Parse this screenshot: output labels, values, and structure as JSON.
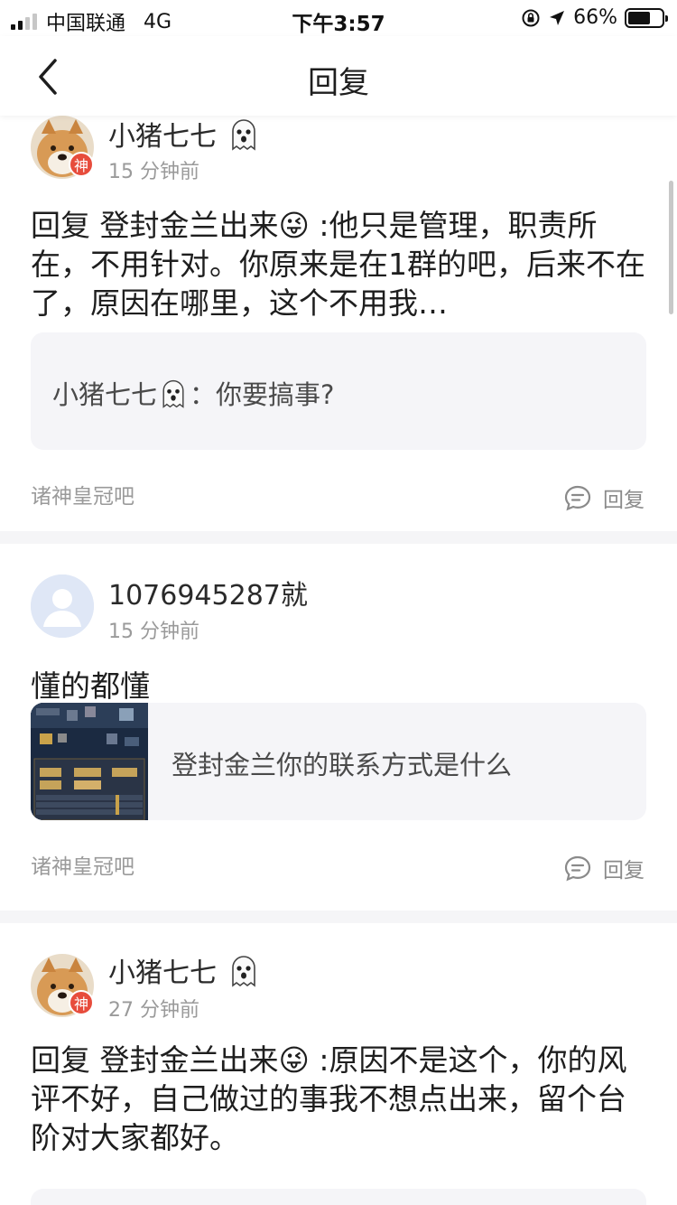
{
  "status_bar": {
    "carrier": "中国联通",
    "network": "4G",
    "time": "下午3:57",
    "battery_percent": "66%",
    "battery_level": 0.66
  },
  "nav": {
    "title": "回复",
    "back_icon": "chevron-left-icon"
  },
  "posts": [
    {
      "username": "小猪七七",
      "username_emoji": "ghost",
      "time": "15 分钟前",
      "avatar": "shiba-dog",
      "badge": "神",
      "content": "回复 登封金兰出来😜 :他只是管理，职责所在，不用针对。你原来是在1群的吧，后来不在了，原因在哪里，这个不用我…",
      "quote_author": "小猪七七",
      "quote_text": "你要搞事?",
      "forum": "诸神皇冠吧",
      "reply_label": "回复"
    },
    {
      "username": "1076945287就",
      "time": "15 分钟前",
      "avatar": "default-user",
      "content": "懂的都懂",
      "quote_text": "登封金兰你的联系方式是什么",
      "forum": "诸神皇冠吧",
      "reply_label": "回复"
    },
    {
      "username": "小猪七七",
      "username_emoji": "ghost",
      "time": "27 分钟前",
      "avatar": "shiba-dog",
      "badge": "神",
      "content": "回复 登封金兰出来😜 :原因不是这个，你的风评不好，自己做过的事我不想点出来，留个台阶对大家都好。"
    }
  ],
  "colors": {
    "badge": "#e74c3c",
    "page_bg": "#f5f5f7",
    "quote_bg": "#f5f5f8",
    "secondary_text": "#9a9a9a"
  }
}
